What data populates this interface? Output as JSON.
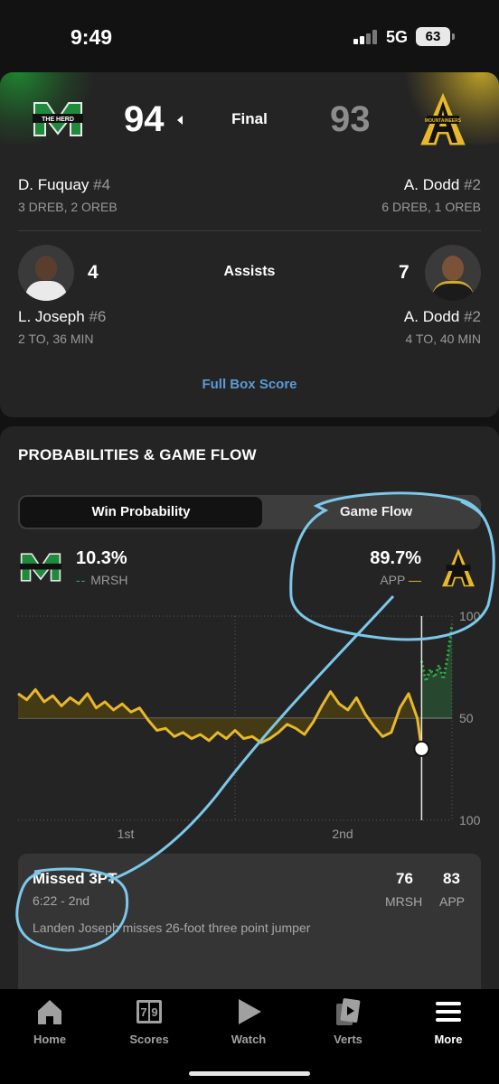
{
  "status_bar": {
    "time": "9:49",
    "network": "5G",
    "battery": "63"
  },
  "game": {
    "home": {
      "score": "94",
      "logo_text": "THE HERD",
      "color": "#1f8a3b"
    },
    "away": {
      "score": "93",
      "logo_text": "MOUNTAINEERS",
      "color": "#e8b82a"
    },
    "status": "Final"
  },
  "leaders": {
    "rebounds": {
      "home": {
        "name": "D. Fuquay",
        "number": "#4",
        "stat": "3 DREB, 2 OREB"
      },
      "away": {
        "name": "A. Dodd",
        "number": "#2",
        "stat": "6 DREB, 1 OREB"
      }
    },
    "assists": {
      "label": "Assists",
      "home": {
        "name": "L. Joseph",
        "number": "#6",
        "value": "4",
        "stat": "2 TO, 36 MIN"
      },
      "away": {
        "name": "A. Dodd",
        "number": "#2",
        "value": "7",
        "stat": "4 TO, 40 MIN"
      }
    },
    "full_box_score": "Full Box Score"
  },
  "probabilities": {
    "title": "PROBABILITIES & GAME FLOW",
    "tabs": [
      "Win Probability",
      "Game Flow"
    ],
    "active_tab": "Win Probability",
    "home": {
      "pct": "10.3%",
      "abbr": "MRSH"
    },
    "away": {
      "pct": "89.7%",
      "abbr": "APP"
    }
  },
  "chart_data": {
    "type": "line",
    "x_tick_labels": [
      "1st",
      "2nd"
    ],
    "y_tick_labels": [
      "100",
      "50",
      "100"
    ],
    "ylim": [
      0,
      100
    ],
    "series": [
      {
        "name": "APP",
        "color": "#e8b82a",
        "style": "solid",
        "x": [
          0,
          2,
          4,
          6,
          8,
          10,
          12,
          14,
          16,
          18,
          20,
          22,
          24,
          26,
          28,
          30,
          32,
          34,
          36,
          38,
          40,
          42,
          44,
          46,
          48,
          50,
          52,
          54,
          56,
          58,
          60,
          62,
          64,
          66,
          68,
          70,
          72,
          74,
          76,
          78,
          80,
          82,
          84,
          86,
          88,
          90,
          92,
          93
        ],
        "y": [
          62,
          59,
          64,
          58,
          61,
          56,
          60,
          57,
          62,
          55,
          58,
          54,
          57,
          53,
          55,
          49,
          44,
          45,
          41,
          43,
          40,
          42,
          39,
          43,
          40,
          44,
          40,
          41,
          38,
          40,
          43,
          47,
          45,
          42,
          48,
          56,
          63,
          57,
          54,
          60,
          52,
          46,
          41,
          43,
          55,
          62,
          50,
          35
        ]
      },
      {
        "name": "MRSH",
        "color": "#2fae4a",
        "style": "dotted",
        "x": [
          93,
          94,
          95,
          96,
          97,
          98,
          99,
          100
        ],
        "y": [
          78,
          68,
          74,
          70,
          76,
          69,
          80,
          96
        ]
      }
    ],
    "marker_x": 93
  },
  "play": {
    "title": "Missed 3PT",
    "time": "6:22 - 2nd",
    "description": "Landen Joseph misses 26-foot three point jumper",
    "home_score": "76",
    "away_score": "83",
    "home_abbr": "MRSH",
    "away_abbr": "APP"
  },
  "nav": {
    "items": [
      {
        "label": "Home",
        "icon": "home-icon"
      },
      {
        "label": "Scores",
        "icon": "scores-icon"
      },
      {
        "label": "Watch",
        "icon": "play-icon"
      },
      {
        "label": "Verts",
        "icon": "verts-icon"
      },
      {
        "label": "More",
        "icon": "menu-icon"
      }
    ],
    "current": "More"
  },
  "annotation_color": "#7cc8ea"
}
